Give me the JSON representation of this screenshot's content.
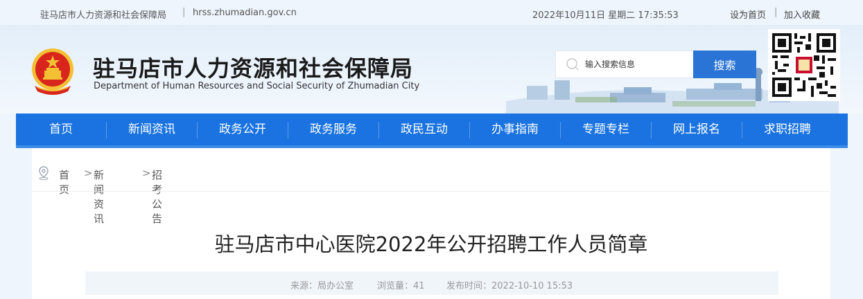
{
  "topbar": {
    "site_name": "驻马店市人力资源和社会保障局",
    "separator": "|",
    "url": "hrss.zhumadian.gov.cn",
    "datetime": "2022年10月11日 星期二 17:35:53",
    "set_home": "设为首页",
    "add_favorite": "加入收藏"
  },
  "header": {
    "title_cn": "驻马店市人力资源和社会保障局",
    "title_en": "Department of Human Resources and Social Security of Zhumadian City",
    "emblem_icon": "national-emblem-icon",
    "search_placeholder": "输入搜索信息",
    "search_button": "搜索",
    "qr_icon": "qr-code-icon"
  },
  "nav": {
    "items": [
      "首页",
      "新闻资讯",
      "政务公开",
      "政务服务",
      "政民互动",
      "办事指南",
      "专题专栏",
      "网上报名",
      "求职招聘"
    ]
  },
  "breadcrumb": {
    "icon": "location-pin-icon",
    "home": "首页",
    "arrow": ">",
    "section": "新闻资讯",
    "current": "招考公告"
  },
  "article": {
    "title": "驻马店市中心医院2022年公开招聘工作人员简章",
    "source": "来源：局办公室",
    "views": "浏览量：41",
    "published": "发布时间：2022-10-10 15:53"
  },
  "colors": {
    "nav_bg": "#1a73e0",
    "search_btn": "#2a74d6",
    "emblem_red": "#d8261c",
    "emblem_gold": "#f3c034"
  }
}
